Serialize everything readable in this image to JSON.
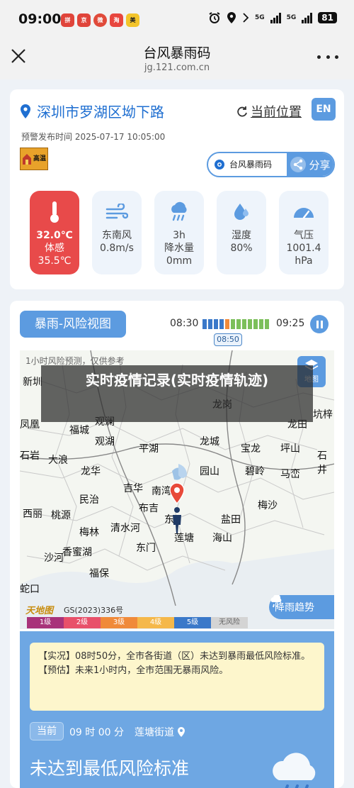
{
  "status_bar": {
    "time": "09:00",
    "network_a": "5G",
    "network_b": "5G",
    "battery": "81",
    "notifications": [
      "pinduoduo",
      "jd",
      "weibo",
      "taobao",
      "meituan"
    ]
  },
  "header": {
    "title": "台风暴雨码",
    "url": "jg.121.com.cn",
    "close_icon": "close-icon",
    "more_icon": "more-icon"
  },
  "weather_card": {
    "location": "深圳市罗湖区坳下路",
    "current_location_label": "当前位置",
    "lang_button": "EN",
    "warning_time": "预警发布时间 2025-07-17 10:05:00",
    "warning_badge_label": "高温",
    "share_pill": {
      "left_label": "台风暴雨码",
      "right_label": "分享"
    },
    "tiles": [
      {
        "icon": "thermometer-icon",
        "line1": "32.0℃",
        "line2": "体感",
        "line3": "35.5℃",
        "highlight": true
      },
      {
        "icon": "wind-icon",
        "line1": "东南风",
        "line2": "0.8m/s",
        "line3": "",
        "highlight": false
      },
      {
        "icon": "rain-cloud-icon",
        "line1": "3h",
        "line2": "降水量",
        "line3": "0mm",
        "highlight": false
      },
      {
        "icon": "humidity-icon",
        "line1": "湿度",
        "line2": "80%",
        "line3": "",
        "highlight": false
      },
      {
        "icon": "gauge-icon",
        "line1": "气压",
        "line2": "1001.4",
        "line3": "hPa",
        "highlight": false
      }
    ]
  },
  "risk_card": {
    "tab_label": "暴雨-风险视图",
    "timeline": {
      "start": "08:30",
      "end": "09:25",
      "current": "08:50"
    },
    "map": {
      "note": "1小时风险预测，仅供参考",
      "layers_label": "地图",
      "trend_label": "降雨趋势",
      "logo": "天地图",
      "gs_number": "GS(2023)336号",
      "place_names": [
        "新圳",
        "龙岗",
        "龙田",
        "坑梓",
        "凤凰",
        "观澜",
        "福城",
        "观湖",
        "平湖",
        "龙城",
        "宝龙",
        "坪山",
        "石井",
        "石岩",
        "大浪",
        "龙华",
        "园山",
        "碧岭",
        "马峦",
        "吉华",
        "南湾",
        "民治",
        "布吉",
        "东",
        "盐田",
        "梅沙",
        "西丽",
        "桃源",
        "梅林",
        "清水河",
        "莲塘",
        "海山",
        "沙河",
        "香蜜湖",
        "东门",
        "蛇口",
        "福保"
      ]
    },
    "legend": [
      "1级",
      "2级",
      "3级",
      "4级",
      "5级",
      "无风险"
    ],
    "legend_colors": [
      "#a8327a",
      "#e8506a",
      "#f08a3a",
      "#f5b84a",
      "#3a78c9",
      "#d4d4d4"
    ],
    "info": {
      "line1": "【实况】08时50分，全市各街道（区）未达到暴雨最低风险标准。",
      "line2": "【预估】未来1小时内，全市范围无暴雨风险。"
    },
    "now_tag": "当前",
    "now_time": "09 时 00 分",
    "now_place": "莲塘街道",
    "status_text": "未达到最低风险标准"
  },
  "overlay": {
    "text": "实时疫情记录(实时疫情轨迹)"
  }
}
